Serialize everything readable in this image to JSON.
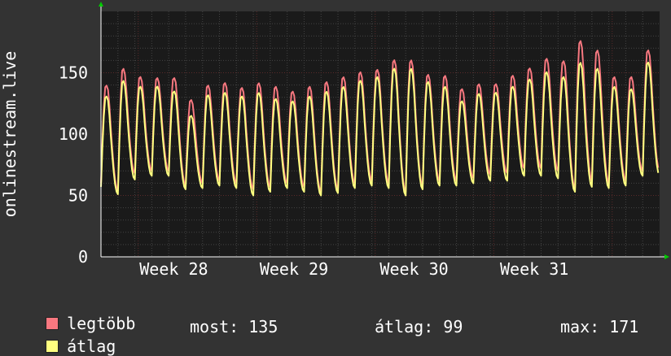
{
  "chart_data": {
    "type": "line",
    "ylabel": "onlinestream.live",
    "ylim": [
      0,
      200
    ],
    "yticks": [
      0,
      50,
      100,
      150
    ],
    "xtick_labels": [
      "Week 28",
      "Week 29",
      "Week 30",
      "Week 31"
    ],
    "grid": true,
    "days": 33,
    "series": [
      {
        "name": "legtöbb",
        "color": "#f87880",
        "daily_peaks": [
          141,
          155,
          148,
          147,
          147,
          129,
          141,
          143,
          139,
          143,
          140,
          136,
          140,
          144,
          148,
          152,
          154,
          162,
          162,
          150,
          149,
          138,
          142,
          142,
          149,
          155,
          163,
          161,
          178,
          170,
          148,
          148,
          170
        ],
        "daily_lows": [
          60,
          54,
          68,
          70,
          70,
          58,
          60,
          62,
          60,
          55,
          57,
          60,
          57,
          53,
          55,
          60,
          62,
          60,
          53,
          58,
          62,
          62,
          64,
          67,
          68,
          72,
          72,
          70,
          56,
          62,
          60,
          62,
          70
        ]
      },
      {
        "name": "átlag",
        "color": "#ffff80",
        "daily_peaks": [
          132,
          145,
          140,
          140,
          136,
          116,
          133,
          135,
          132,
          135,
          130,
          128,
          132,
          136,
          140,
          145,
          148,
          155,
          155,
          144,
          140,
          128,
          134,
          135,
          140,
          146,
          152,
          148,
          160,
          155,
          140,
          138,
          160
        ],
        "daily_lows": [
          57,
          51,
          63,
          66,
          66,
          55,
          56,
          58,
          56,
          50,
          53,
          56,
          53,
          50,
          52,
          56,
          58,
          56,
          50,
          55,
          58,
          58,
          60,
          62,
          62,
          66,
          66,
          64,
          53,
          57,
          56,
          58,
          66
        ]
      }
    ]
  },
  "legend": {
    "max_label": "legtöbb",
    "avg_label": "átlag"
  },
  "stats": {
    "current": "most: 135",
    "average": "átlag: 99",
    "maximum": "max: 171"
  },
  "colors": {
    "background": "#333333",
    "plot_bg": "#1a1a1a",
    "grid_major": "#5a2a2a",
    "grid_minor": "#444444",
    "axis": "#ffffff",
    "arrow": "#00cc00"
  }
}
